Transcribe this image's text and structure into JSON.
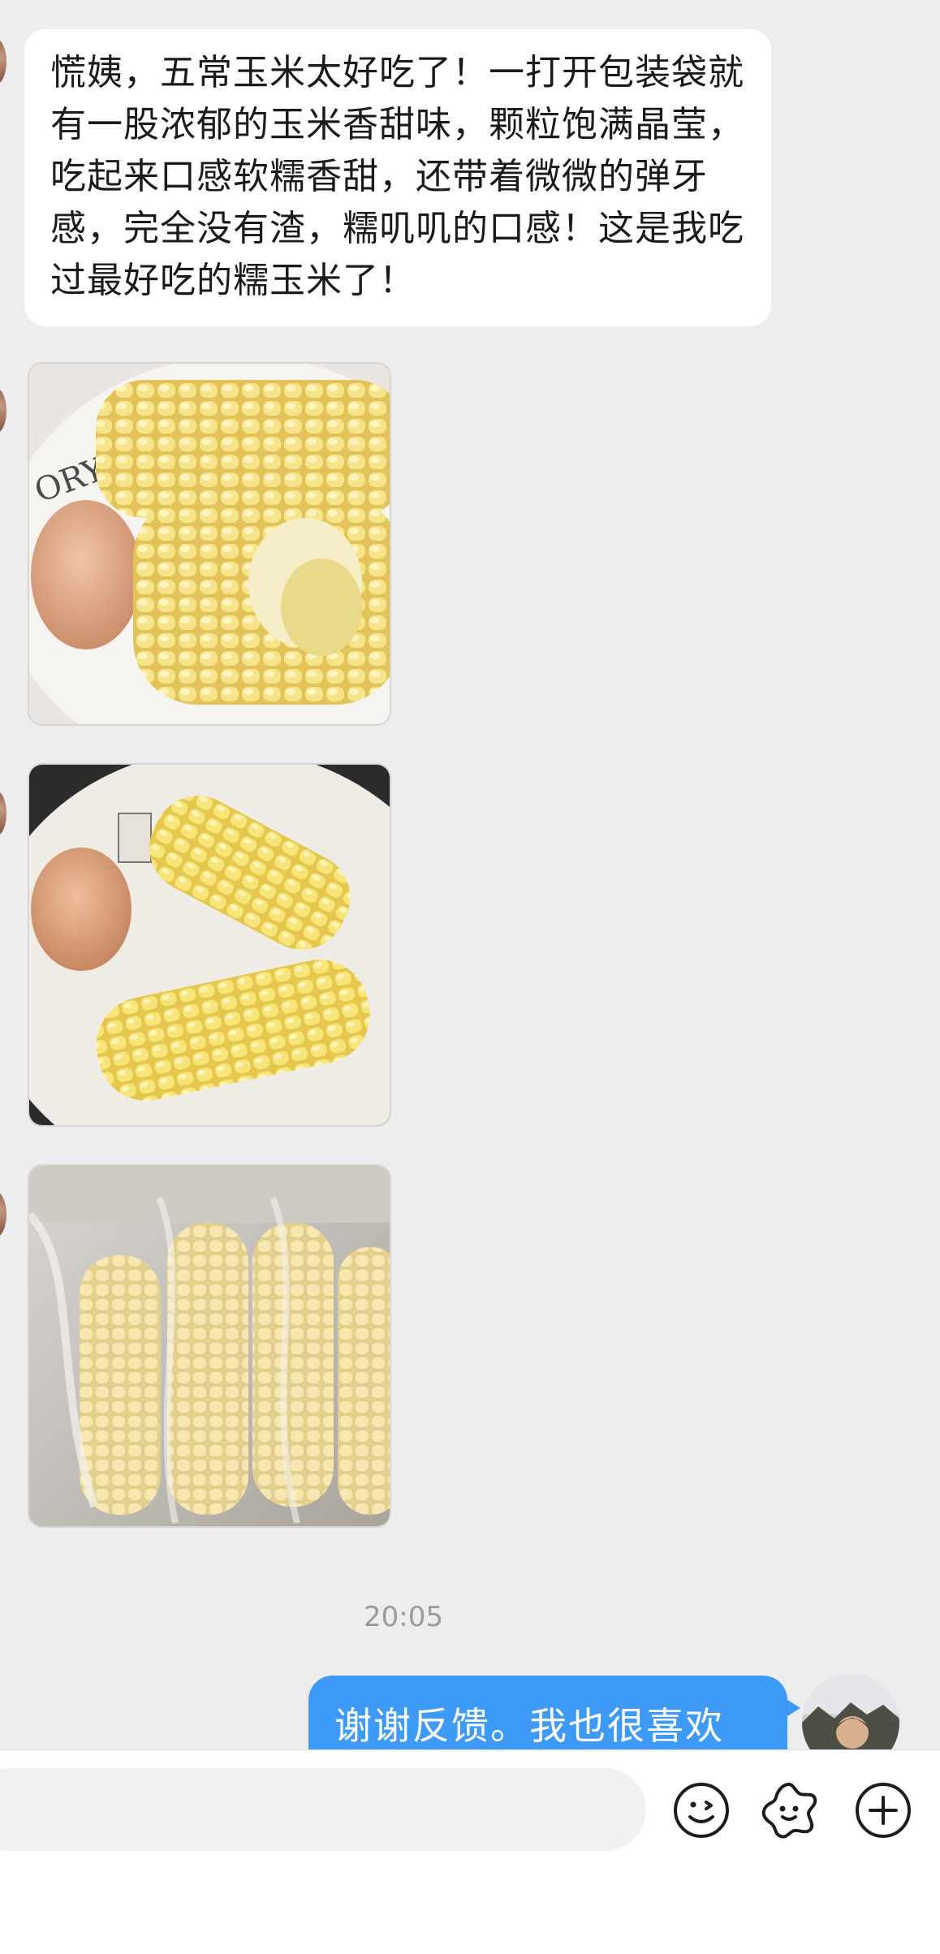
{
  "chat": {
    "incoming_text": "慌姨，五常玉米太好吃了！一打开包装袋就有一股浓郁的玉米香甜味，颗粒饱满晶莹，吃起来口感软糯香甜，还带着微微的弹牙感，完全没有渣，糯叽叽的口感！这是我吃过最好吃的糯玉米了！",
    "images": [
      {
        "icon": "corn-on-plate-photo"
      },
      {
        "icon": "corn-and-egg-photo"
      },
      {
        "icon": "packaged-corn-photo"
      }
    ],
    "timestamp": "20:05",
    "outgoing_text": "谢谢反馈。我也很喜欢吃"
  },
  "input_bar": {
    "placeholder": "",
    "emoji_icon": "emoji-icon",
    "sticker_icon": "sticker-icon",
    "plus_icon": "plus-icon"
  },
  "colors": {
    "background": "#ededed",
    "incoming_bubble": "#ffffff",
    "outgoing_bubble": "#3d9bf7",
    "timestamp": "#9a9a9a"
  }
}
